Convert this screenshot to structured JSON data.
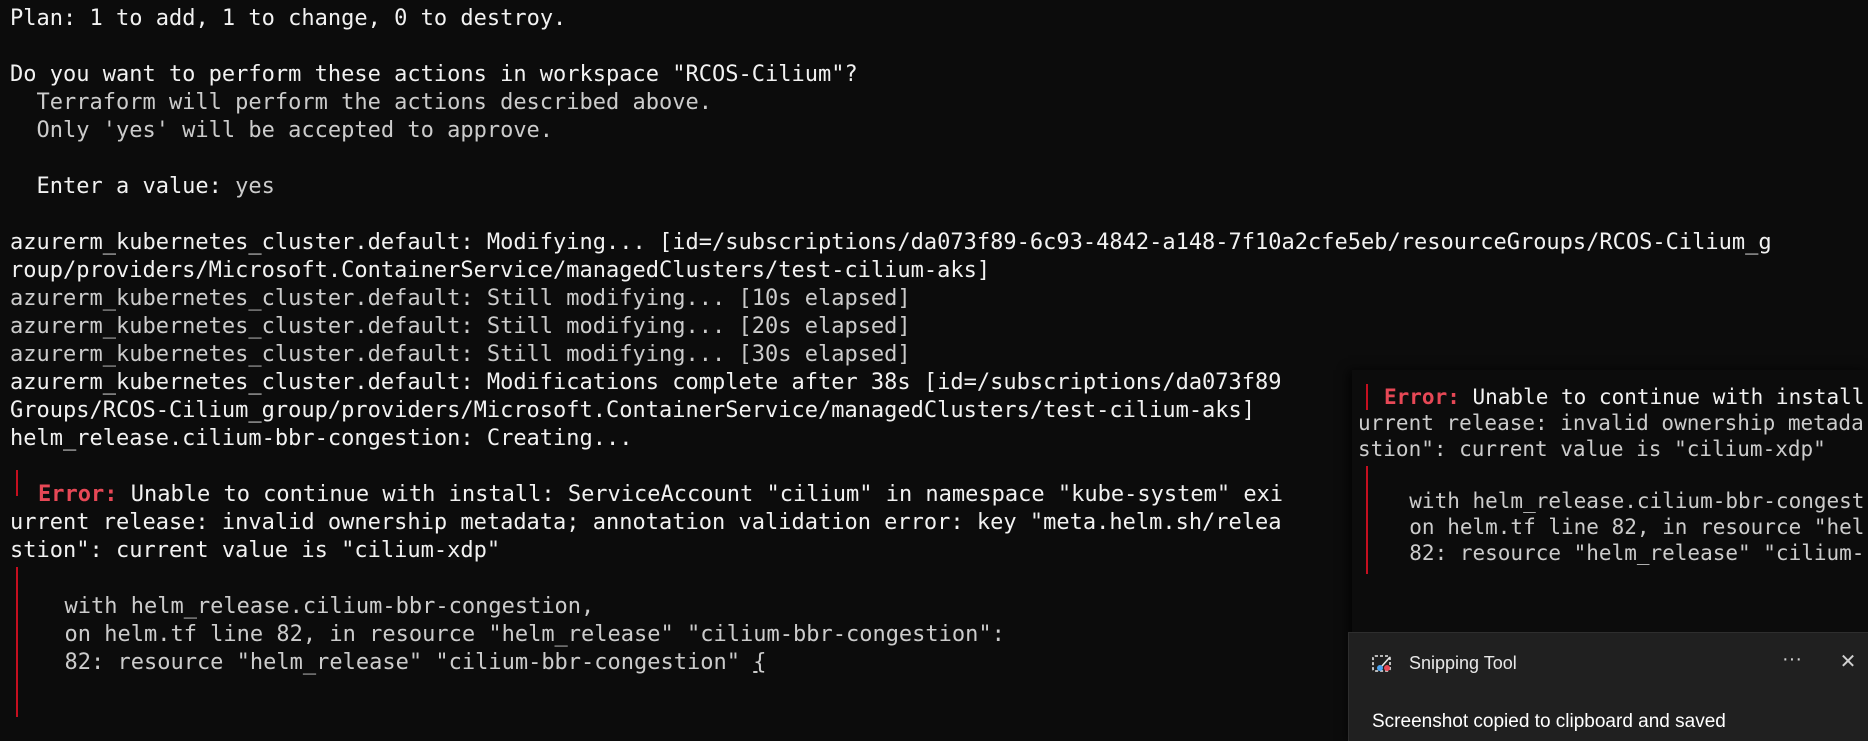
{
  "terminal": {
    "plan_label": "Plan:",
    "plan_text": " 1 to add, 1 to change, 0 to destroy.",
    "prompt_question": "Do you want to perform these actions in workspace \"RCOS-Cilium\"?",
    "prompt_note_1": "  Terraform will perform the actions described above.",
    "prompt_note_2": "  Only 'yes' will be accepted to approve.",
    "enter_value_label": "  Enter a value:",
    "enter_value_input": " yes",
    "log_1": "azurerm_kubernetes_cluster.default: Modifying... [id=/subscriptions/da073f89-6c93-4842-a148-7f10a2cfe5eb/resourceGroups/RCOS-Cilium_g",
    "log_2": "roup/providers/Microsoft.ContainerService/managedClusters/test-cilium-aks]",
    "log_3": "azurerm_kubernetes_cluster.default: Still modifying... [10s elapsed]",
    "log_4": "azurerm_kubernetes_cluster.default: Still modifying... [20s elapsed]",
    "log_5": "azurerm_kubernetes_cluster.default: Still modifying... [30s elapsed]",
    "log_6": "azurerm_kubernetes_cluster.default: Modifications complete after 38s [id=/subscriptions/da073f89",
    "log_7": "Groups/RCOS-Cilium_group/providers/Microsoft.ContainerService/managedClusters/test-cilium-aks]",
    "log_8": "helm_release.cilium-bbr-congestion: Creating...",
    "error_label": "Error:",
    "error_line_1": " Unable to continue with install: ServiceAccount \"cilium\" in namespace \"kube-system\" exi",
    "error_line_2": "urrent release: invalid ownership metadata; annotation validation error: key \"meta.helm.sh/relea",
    "error_line_3": "stion\": current value is \"cilium-xdp\"",
    "with_line": "  with helm_release.cilium-bbr-congestion,",
    "on_line": "  on helm.tf line 82, in resource \"helm_release\" \"cilium-bbr-congestion\":",
    "code_line": "  82: resource \"helm_release\" \"cilium-bbr-congestion\" ",
    "cursor_char": "{"
  },
  "overlay": {
    "error_label": "Error:",
    "error_line_1": " Unable to continue with install",
    "error_line_2": "urrent release: invalid ownership metada",
    "error_line_3": "stion\": current value is \"cilium-xdp\"",
    "with_line": "  with helm_release.cilium-bbr-congest",
    "on_line": "  on helm.tf line 82, in resource \"hel",
    "code_line": "  82: resource \"helm_release\" \"cilium-"
  },
  "toast": {
    "app_name": "Snipping Tool",
    "more_label": "···",
    "close_label": "✕",
    "message": "Screenshot copied to clipboard and saved",
    "icon": "snipping-tool-icon"
  },
  "colors": {
    "background": "#0c0c0c",
    "text": "#cccccc",
    "error": "#e74856",
    "error_bar": "#c50f1f",
    "toast_bg": "#202020"
  }
}
